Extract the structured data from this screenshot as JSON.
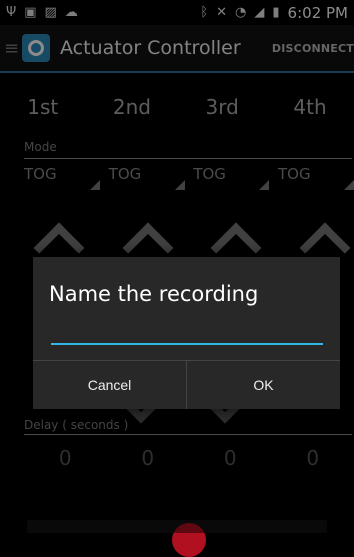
{
  "status_bar": {
    "left_icons": [
      "usb-icon",
      "sim-icon",
      "image-icon",
      "cloud-upload-icon"
    ],
    "right_icons": [
      "bluetooth-icon",
      "mute-icon",
      "wifi-icon",
      "signal-icon",
      "battery-icon"
    ],
    "time": "6:02 PM"
  },
  "action_bar": {
    "title": "Actuator Controller",
    "disconnect_label": "DISCONNECT"
  },
  "positions": [
    "1st",
    "2nd",
    "3rd",
    "4th"
  ],
  "mode": {
    "label": "Mode",
    "values": [
      "TOG",
      "TOG",
      "TOG",
      "TOG"
    ]
  },
  "delay": {
    "label": "Delay ( seconds )",
    "values": [
      "0",
      "0",
      "0",
      "0"
    ]
  },
  "dialog": {
    "title": "Name the recording",
    "input_value": "",
    "cancel_label": "Cancel",
    "ok_label": "OK"
  },
  "colors": {
    "accent": "#33b5e5",
    "action_bar_line": "#2d6f95",
    "record_button": "#b01020"
  }
}
